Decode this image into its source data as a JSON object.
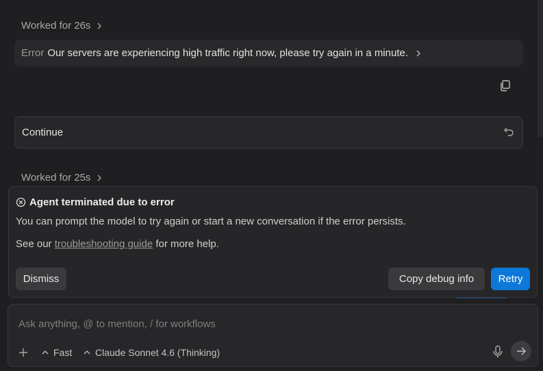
{
  "history": {
    "worked_1": "Worked for 26s",
    "error_label": "Error",
    "error_message": "Our servers are experiencing high traffic right now, please try again in a minute.",
    "continue_text": "Continue",
    "worked_2": "Worked for 25s"
  },
  "error_card": {
    "title": "Agent terminated due to error",
    "line1": "You can prompt the model to try again or start a new conversation if the error persists.",
    "line2_prefix": "See our ",
    "line2_link": "troubleshooting guide",
    "line2_suffix": " for more help.",
    "dismiss_label": "Dismiss",
    "copy_debug_label": "Copy debug info",
    "retry_label": "Retry"
  },
  "input": {
    "placeholder": "Ask anything, @ to mention, / for workflows",
    "mode_label": "Fast",
    "model_label": "Claude Sonnet 4.6 (Thinking)"
  },
  "icons": {
    "chevron": "chevron-right-icon",
    "copy": "copy-icon",
    "undo": "undo-icon",
    "error": "circle-x-icon",
    "plus": "plus-icon",
    "caret": "chevron-up-icon",
    "mic": "microphone-icon",
    "send": "arrow-right-icon"
  },
  "colors": {
    "background": "#1f1f21",
    "accent": "#0e78d8",
    "panel": "#262628"
  }
}
